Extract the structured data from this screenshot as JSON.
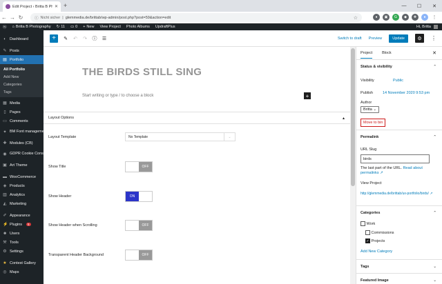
{
  "browser": {
    "tab_title": "Edit Project ‹ Britta B Photograp",
    "security_label": "Nicht sicher",
    "url": "glemmedia.de/brittab/wp-admin/post.php?post=59&action=edit"
  },
  "admin_bar": {
    "site_name": "Britta B Photography",
    "updates": "11",
    "comments": "0",
    "new_label": "New",
    "items": [
      "View Project",
      "Photo Albums",
      "UpdraftPlus"
    ],
    "greeting": "Hi, Britta"
  },
  "sidebar": {
    "items": [
      {
        "label": "Dashboard",
        "icon": "dashboard-icon"
      },
      {
        "label": "Posts",
        "icon": "pin-icon"
      },
      {
        "label": "Portfolio",
        "icon": "portfolio-icon"
      },
      {
        "label": "Media",
        "icon": "media-icon"
      },
      {
        "label": "Pages",
        "icon": "page-icon"
      },
      {
        "label": "Comments",
        "icon": "comment-icon"
      },
      {
        "label": "BM Font management",
        "icon": "font-icon"
      },
      {
        "label": "Modules (CB)",
        "icon": "modules-icon"
      },
      {
        "label": "GDPR Cookie Consent",
        "icon": "cookie-icon"
      },
      {
        "label": "Art Theme",
        "icon": "theme-icon"
      },
      {
        "label": "WooCommerce",
        "icon": "woo-icon"
      },
      {
        "label": "Products",
        "icon": "products-icon"
      },
      {
        "label": "Analytics",
        "icon": "analytics-icon"
      },
      {
        "label": "Marketing",
        "icon": "marketing-icon"
      },
      {
        "label": "Appearance",
        "icon": "appearance-icon"
      },
      {
        "label": "Plugins",
        "icon": "plugin-icon",
        "badge": "5"
      },
      {
        "label": "Users",
        "icon": "users-icon"
      },
      {
        "label": "Tools",
        "icon": "tools-icon"
      },
      {
        "label": "Settings",
        "icon": "settings-icon"
      },
      {
        "label": "Contest Gallery",
        "icon": "gallery-icon"
      },
      {
        "label": "Maps",
        "icon": "maps-icon"
      }
    ],
    "submenu": [
      "All Portfolio",
      "Add New",
      "Categories",
      "Tags"
    ]
  },
  "editor_toolbar": {
    "switch_draft": "Switch to draft",
    "preview": "Preview",
    "update": "Update"
  },
  "post": {
    "title": "THE BIRDS STILL SING",
    "block_placeholder": "Start writing or type / to choose a block"
  },
  "layout_options": {
    "heading": "Layout Options",
    "template_label": "Layout Template",
    "template_value": "No Template",
    "fields": [
      {
        "label": "Show Title",
        "state": "OFF"
      },
      {
        "label": "Show Header",
        "state": "ON"
      },
      {
        "label": "Show Header when Scrolling",
        "state": "OFF"
      },
      {
        "label": "Transparent Header Background",
        "state": "OFF"
      }
    ]
  },
  "settings_panel": {
    "tab_project": "Project",
    "tab_block": "Block",
    "status_heading": "Status & visibility",
    "visibility_label": "Visibility",
    "visibility_value": "Public",
    "publish_label": "Publish",
    "publish_value": "14 November 2020 9:53 pm",
    "author_label": "Author",
    "author_value": "Britta",
    "trash": "Move to bin",
    "permalink_heading": "Permalink",
    "url_slug_label": "URL Slug",
    "url_slug_value": "birds",
    "slug_help": "The last part of the URL.",
    "read_about": "Read about permalinks",
    "view_project_label": "View Project",
    "view_project_url": "http://glemmedia.de/brittab/ux-portfolio/birds/",
    "categories_heading": "Categories",
    "categories": [
      {
        "label": "Work",
        "checked": false
      },
      {
        "label": "Commissions",
        "checked": false
      },
      {
        "label": "Projects",
        "checked": true
      }
    ],
    "add_category": "Add New Category",
    "tags_heading": "Tags",
    "featured_heading": "Featured Image"
  },
  "colors": {
    "wp_dark": "#1d2327",
    "wp_blue": "#007cba",
    "toggle_on": "#2c35c9",
    "trash_red": "#cc1818"
  }
}
